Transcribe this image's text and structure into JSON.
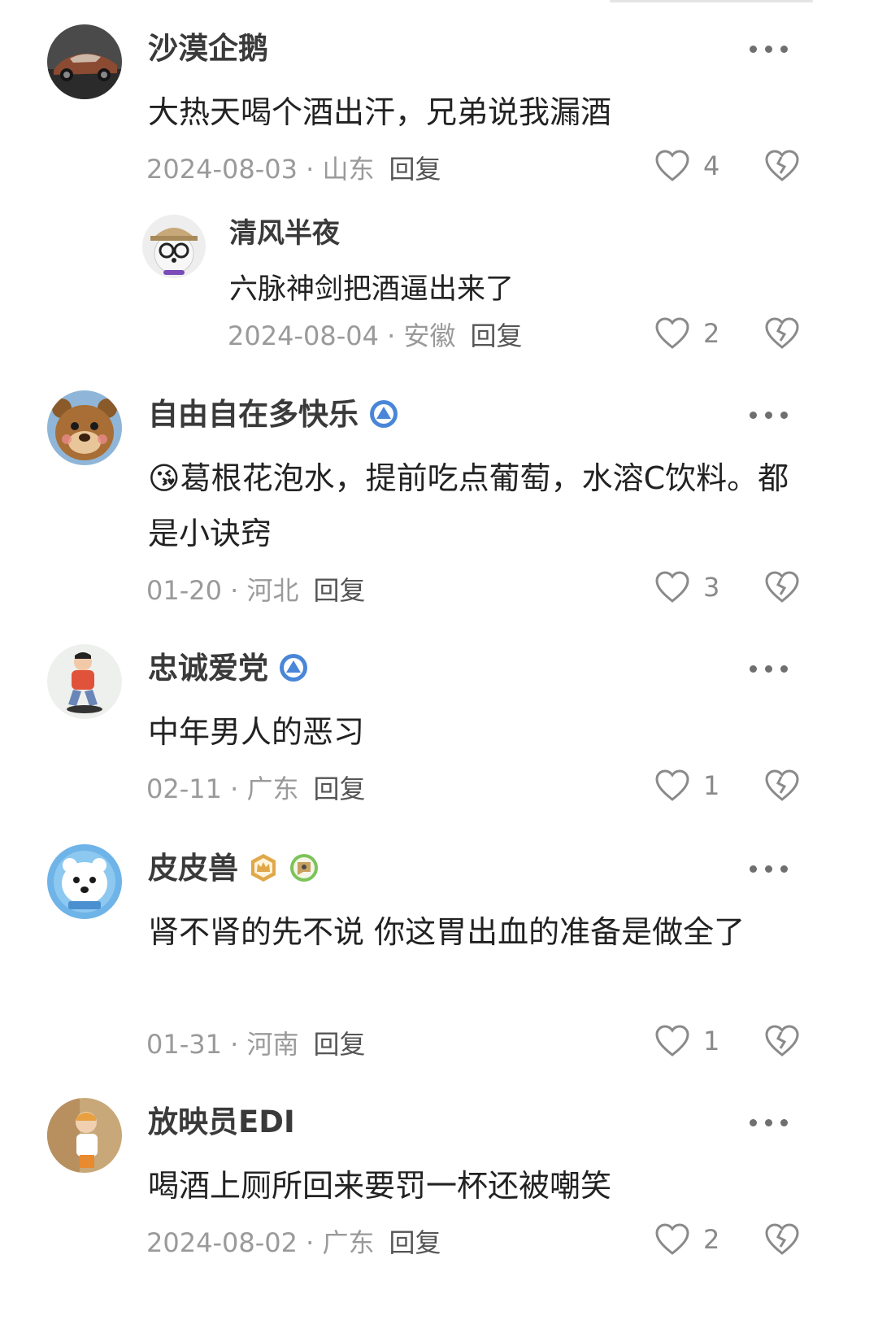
{
  "comments": [
    {
      "name": "沙漠企鹅",
      "text": "大热天喝个酒出汗，兄弟说我漏酒",
      "date": "2024-08-03 · 山东",
      "reply_label": "回复",
      "likes": "4",
      "avatar_icon": "sports-car-avatar",
      "reply": {
        "name": "清风半夜",
        "text": "六脉神剑把酒逼出来了",
        "date": "2024-08-04 · 安徽",
        "reply_label": "回复",
        "likes": "2",
        "avatar_icon": "dog-with-glasses-avatar"
      }
    },
    {
      "name": "自由自在多快乐",
      "text": "😘葛根花泡水，提前吃点葡萄，水溶C饮料。都是小诀窍",
      "date": "01-20 · 河北",
      "reply_label": "回复",
      "likes": "3",
      "avatar_icon": "cartoon-bear-avatar",
      "badge_icon": "blue-level-badge-icon"
    },
    {
      "name": "忠诚爱党",
      "text": "中年男人的恶习",
      "date": "02-11 · 广东",
      "reply_label": "回复",
      "likes": "1",
      "avatar_icon": "sitting-man-avatar",
      "badge_icon": "blue-level-badge-icon"
    },
    {
      "name": "皮皮兽",
      "text": "肾不肾的先不说 你这胃出血的准备是做全了",
      "date": "01-31 · 河南",
      "reply_label": "回复",
      "likes": "1",
      "avatar_icon": "polar-bear-avatar",
      "badge_icon": "gold-crown-badge-icon",
      "badge2_icon": "green-fan-badge-icon"
    },
    {
      "name": "放映员EDI",
      "text": "喝酒上厕所回来要罚一杯还被嘲笑",
      "date": "2024-08-02 · 广东",
      "reply_label": "回复",
      "likes": "2",
      "avatar_icon": "child-photo-avatar"
    }
  ],
  "colors": {
    "text": "#222222",
    "name": "#3a3a3a",
    "meta": "#9a9a9a",
    "badge_blue": "#4a86d8",
    "badge_gold": "#e0a84a"
  }
}
